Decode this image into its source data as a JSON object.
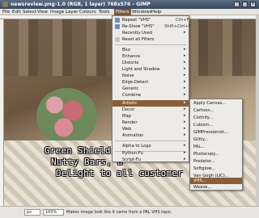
{
  "window": {
    "title": "newsreview.png-1.0 (RGB, 1 layer) 768x576 – GIMP"
  },
  "menubar": [
    "File",
    "Edit",
    "Select",
    "View",
    "Image",
    "Layer",
    "Colours",
    "Tools",
    "Filters",
    "Windows",
    "Help"
  ],
  "filters_menu": {
    "items": [
      {
        "label": "Repeat \"VHS\"",
        "shortcut": "Ctrl+F"
      },
      {
        "label": "Re-Show \"VHS\"",
        "shortcut": "Shift+Ctrl+F"
      },
      {
        "label": "Recently Used"
      },
      {
        "label": "Reset all Filters"
      },
      {
        "label": "Blur"
      },
      {
        "label": "Enhance"
      },
      {
        "label": "Distorts"
      },
      {
        "label": "Light and Shadow"
      },
      {
        "label": "Noise"
      },
      {
        "label": "Edge-Detect"
      },
      {
        "label": "Generic"
      },
      {
        "label": "Combine"
      },
      {
        "label": "Artistic"
      },
      {
        "label": "Decor"
      },
      {
        "label": "Map"
      },
      {
        "label": "Render"
      },
      {
        "label": "Web"
      },
      {
        "label": "Animation"
      },
      {
        "label": "Alpha to Logo"
      },
      {
        "label": "Python-Fu"
      },
      {
        "label": "Script-Fu"
      }
    ]
  },
  "artistic_menu": {
    "items": [
      "Apply Canvas...",
      "Cartoon...",
      "Clothify...",
      "Cubism...",
      "GIMPressionist...",
      "Glitty...",
      "PAL...",
      "Photocopy...",
      "Predator...",
      "Softglow...",
      "Van Gogh (LIC)...",
      "VHS...",
      "Weave..."
    ]
  },
  "image_text": {
    "line1": "Green Shield S",
    "line2": "Nutty Bars, b",
    "line3": "Delight to all customer"
  },
  "statusbar": {
    "unit": "px",
    "zoom": "100%",
    "message": "Makes image look like it came from a PAL VHS tape."
  }
}
